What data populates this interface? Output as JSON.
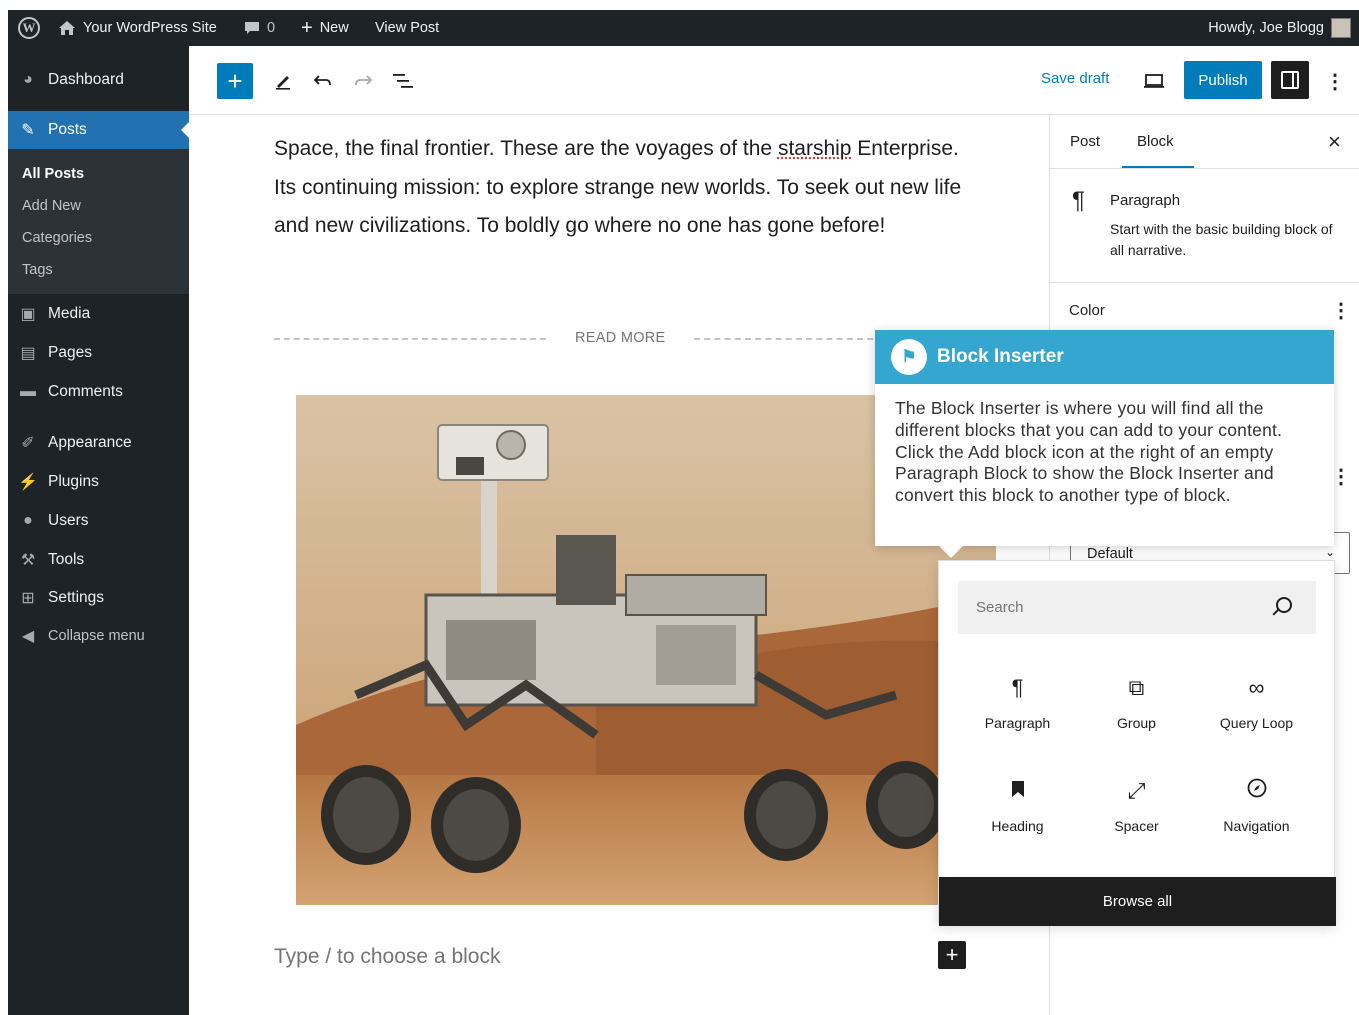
{
  "admin_bar": {
    "site_name": "Your WordPress Site",
    "comments_count": "0",
    "new_label": "New",
    "view_post_label": "View Post",
    "greeting": "Howdy, Joe Blogg"
  },
  "sidebar": {
    "dashboard": "Dashboard",
    "posts": "Posts",
    "posts_submenu": [
      "All Posts",
      "Add New",
      "Categories",
      "Tags"
    ],
    "media": "Media",
    "pages": "Pages",
    "comments": "Comments",
    "appearance": "Appearance",
    "plugins": "Plugins",
    "users": "Users",
    "tools": "Tools",
    "settings": "Settings",
    "collapse": "Collapse menu"
  },
  "toolbar": {
    "save_draft": "Save draft",
    "publish": "Publish"
  },
  "content": {
    "paragraph_before": "Space, the final frontier. These are the voyages of the ",
    "paragraph_misspelled": "starship",
    "paragraph_after": " Enterprise. Its continuing mission: to explore strange new worlds. To seek out new life and new civilizations. To boldly go where no one has gone before!",
    "read_more": "READ MORE",
    "block_placeholder": "Type / to choose a block"
  },
  "settings_panel": {
    "tabs": [
      "Post",
      "Block"
    ],
    "active_tab": "Block",
    "block_name": "Paragraph",
    "block_description": "Start with the basic building block of all narrative.",
    "color_label": "Color",
    "select_value": "Default"
  },
  "guide": {
    "title": "Block Inserter",
    "body": "The Block Inserter is where you will find all the different blocks that you can add to your content. Click the Add block icon at the right of an empty Paragraph Block to show the Block Inserter and convert this block to another type of block."
  },
  "inserter": {
    "search_placeholder": "Search",
    "blocks": [
      {
        "label": "Paragraph",
        "icon": "paragraph-icon"
      },
      {
        "label": "Group",
        "icon": "group-icon"
      },
      {
        "label": "Query Loop",
        "icon": "loop-icon"
      },
      {
        "label": "Heading",
        "icon": "bookmark-icon"
      },
      {
        "label": "Spacer",
        "icon": "resize-icon"
      },
      {
        "label": "Navigation",
        "icon": "compass-icon"
      }
    ],
    "browse_all": "Browse all"
  },
  "colors": {
    "admin_dark": "#1d2327",
    "wp_blue": "#007cba",
    "admin_active": "#2271b1",
    "guide_header": "#34a6d0"
  }
}
